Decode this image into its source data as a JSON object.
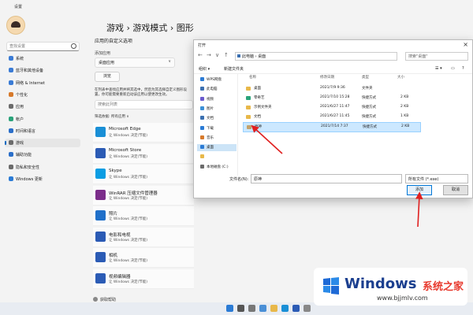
{
  "window": {
    "title": "设置"
  },
  "sidebar": {
    "search_placeholder": "查找设置",
    "items": [
      {
        "label": "系统",
        "color": "#3a7bd5"
      },
      {
        "label": "蓝牙和其他设备",
        "color": "#3a7bd5"
      },
      {
        "label": "网络 & Internet",
        "color": "#3a7bd5"
      },
      {
        "label": "个性化",
        "color": "#d77a2b"
      },
      {
        "label": "应用",
        "color": "#6b6b6b"
      },
      {
        "label": "帐户",
        "color": "#2aa37a"
      },
      {
        "label": "时间和语言",
        "color": "#2b6fc9"
      },
      {
        "label": "游戏",
        "color": "#6b6b6b"
      },
      {
        "label": "辅助功能",
        "color": "#2b6fc9"
      },
      {
        "label": "隐私和安全性",
        "color": "#6b6b6b"
      },
      {
        "label": "Windows 更新",
        "color": "#2b7bd5"
      }
    ],
    "selected_index": 7
  },
  "main": {
    "breadcrumb": "游戏  ›  游戏模式  ›  图形",
    "section_title": "应用的自定义选项",
    "add_app_label": "添加应用",
    "dropdown_value": "桌面应用",
    "browse_button": "浏览",
    "description": "在列表中查找应用并将其选中，然后为其选择自定义图形设置，你可能需要重新启动该应用以使更改生效。",
    "app_search_placeholder": "搜索此列表",
    "filter_label": "筛选依据: 所有应用 ∨",
    "apps": [
      {
        "name": "Microsoft Edge",
        "sub": "让 Windows 决定(节能)",
        "color": "#1a8fd6"
      },
      {
        "name": "Microsoft Store",
        "sub": "让 Windows 决定(节能)",
        "color": "#2b5bb5"
      },
      {
        "name": "Skype",
        "sub": "让 Windows 决定(节能)",
        "color": "#0a9de3"
      },
      {
        "name": "WinRAR 压缩文件管理器",
        "sub": "让 Windows 决定(节能)",
        "color": "#7b2d8a"
      },
      {
        "name": "照片",
        "sub": "让 Windows 决定(节能)",
        "color": "#1f6fc9"
      },
      {
        "name": "电影和电视",
        "sub": "让 Windows 决定(节能)",
        "color": "#2b5bb5"
      },
      {
        "name": "相机",
        "sub": "让 Windows 决定(节能)",
        "color": "#2b5bb5"
      },
      {
        "name": "视频编辑器",
        "sub": "让 Windows 决定(节能)",
        "color": "#2b5bb5"
      }
    ],
    "help_label": "获取帮助"
  },
  "dialog": {
    "title": "打开",
    "address": "此电脑 › 桌面",
    "search_placeholder": "搜索\"桌面\"",
    "toolbar": {
      "organize": "组织 ▾",
      "new_folder": "新建文件夹"
    },
    "tree": [
      {
        "label": "WPS网盘",
        "color": "#2b7bd5"
      },
      {
        "label": "此电脑",
        "color": "#3a6fb0"
      },
      {
        "label": "视频",
        "color": "#6a5acd"
      },
      {
        "label": "图片",
        "color": "#3a8fd6"
      },
      {
        "label": "文档",
        "color": "#3a6fb0"
      },
      {
        "label": "下载",
        "color": "#2b7bd5"
      },
      {
        "label": "音乐",
        "color": "#d77a2b"
      },
      {
        "label": "桌面",
        "color": "#2b7bd5"
      },
      {
        "label": "",
        "color": "#e8b84a"
      },
      {
        "label": "本地磁盘 (C:)",
        "color": "#6b6b6b"
      }
    ],
    "tree_selected_index": 7,
    "columns": {
      "name": "名称",
      "date": "修改日期",
      "type": "类型",
      "size": "大小"
    },
    "files": [
      {
        "name": "桌面",
        "date": "2021/7/9 9:36",
        "type": "文件夹",
        "size": "",
        "color": "#e8b84a"
      },
      {
        "name": "零奇艺",
        "date": "2021/7/10 15:28",
        "type": "快捷方式",
        "size": "2 KB",
        "color": "#2aa37a"
      },
      {
        "name": "示例文件夹",
        "date": "2021/6/27 11:47",
        "type": "快捷方式",
        "size": "2 KB",
        "color": "#e8b84a"
      },
      {
        "name": "文档",
        "date": "2021/6/27 11:45",
        "type": "快捷方式",
        "size": "1 KB",
        "color": "#e8b84a"
      },
      {
        "name": "原神",
        "date": "2021/7/14 7:37",
        "type": "快捷方式",
        "size": "2 KB",
        "color": "#c4a26b"
      }
    ],
    "selected_file_index": 4,
    "filename_label": "文件名(N):",
    "filename_value": "原神",
    "filetype_value": "所有文件 (*.exe)",
    "ok_button": "添加",
    "cancel_button": "取消"
  },
  "watermark": {
    "brand": "Windows",
    "brand_cn": "系统之家",
    "url": "www.bjjmlv.com"
  }
}
